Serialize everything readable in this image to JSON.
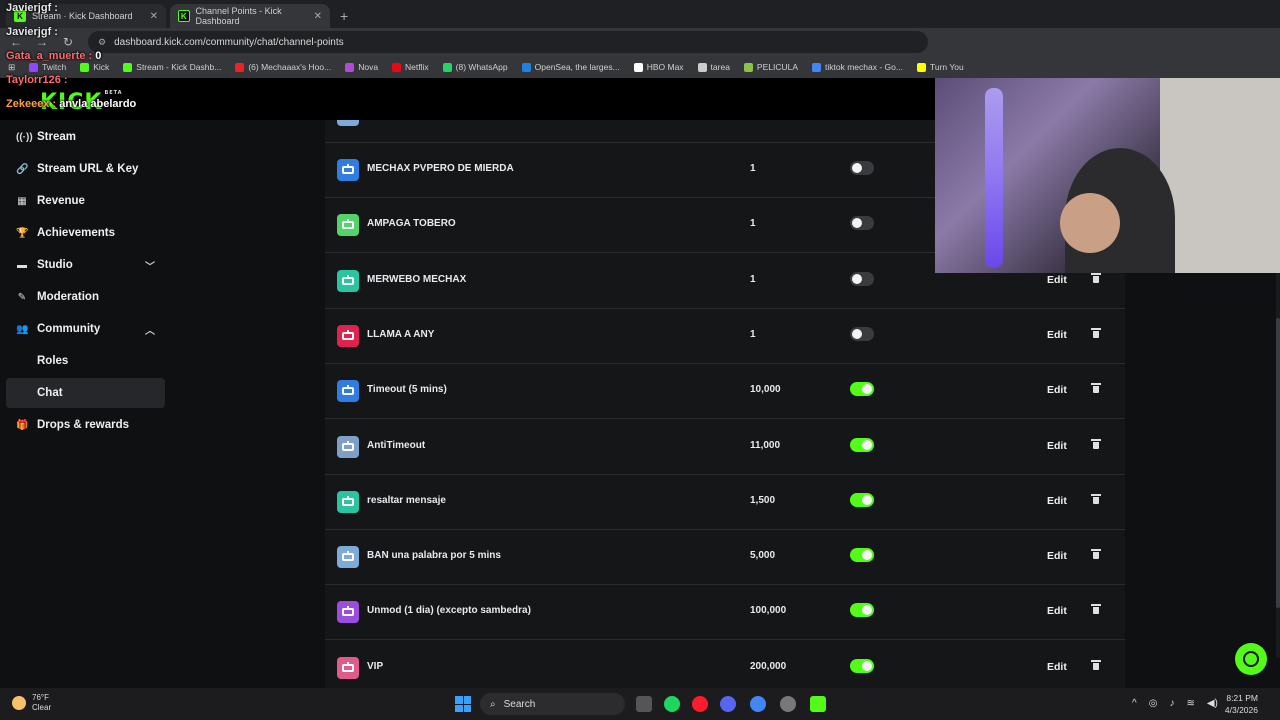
{
  "browser": {
    "tabs": [
      {
        "label": "Stream · Kick Dashboard",
        "active": false
      },
      {
        "label": "Channel Points - Kick Dashboard",
        "active": true
      }
    ],
    "url": "dashboard.kick.com/community/chat/channel-points",
    "bookmarks": [
      "Twitch",
      "Kick",
      "Stream - Kick Dashb...",
      "(6) Mechaaax's Hoo...",
      "Nova",
      "Netflix",
      "(8) WhatsApp",
      "OpenSea, the larges...",
      "HBO Max",
      "tarea",
      "PELICULA",
      "tiktok mechax - Go...",
      "Turn You"
    ]
  },
  "logo": {
    "text": "KICK",
    "tag": "BETA"
  },
  "sidebar": {
    "items": [
      {
        "label": "Stream",
        "icon": "broadcast-icon"
      },
      {
        "label": "Stream URL & Key",
        "icon": "link-icon"
      },
      {
        "label": "Revenue",
        "icon": "chart-icon"
      },
      {
        "label": "Achievements",
        "icon": "trophy-icon"
      },
      {
        "label": "Studio",
        "icon": "video-icon"
      },
      {
        "label": "Moderation",
        "icon": "wrench-icon"
      },
      {
        "label": "Community",
        "icon": "users-icon"
      },
      {
        "label": "Roles",
        "icon": ""
      },
      {
        "label": "Chat",
        "icon": ""
      },
      {
        "label": "Drops & rewards",
        "icon": "gift-icon"
      }
    ]
  },
  "rewards": [
    {
      "name": "MECHAX PVPERO DE MIERDA",
      "cost": "1",
      "enabled": false,
      "color": "#2f7de1"
    },
    {
      "name": "AMPAGA TOBERO",
      "cost": "1",
      "enabled": false,
      "color": "#53d36a"
    },
    {
      "name": "MERWEBO MECHAX",
      "cost": "1",
      "enabled": false,
      "color": "#2bc4a0"
    },
    {
      "name": "LLAMA A ANY",
      "cost": "1",
      "enabled": false,
      "color": "#e0234e"
    },
    {
      "name": "Timeout (5 mins)",
      "cost": "10,000",
      "enabled": true,
      "color": "#2f7de1"
    },
    {
      "name": "AntiTimeout",
      "cost": "11,000",
      "enabled": true,
      "color": "#7ea0c8"
    },
    {
      "name": "resaltar mensaje",
      "cost": "1,500",
      "enabled": true,
      "color": "#2bc4a0"
    },
    {
      "name": "BAN una palabra por 5 mins",
      "cost": "5,000",
      "enabled": true,
      "color": "#7eaad8"
    },
    {
      "name": "Unmod (1 dia) (excepto sambedra)",
      "cost": "100,000",
      "enabled": true,
      "color": "#9b4de0"
    },
    {
      "name": "VIP",
      "cost": "200,000",
      "enabled": true,
      "color": "#e05a8a"
    }
  ],
  "actions": {
    "edit": "Edit"
  },
  "chat_overlay": [
    {
      "user": "Javierjgf :",
      "msg": ""
    },
    {
      "user": "Javierjgf :",
      "msg": ""
    },
    {
      "user": "Gata_a_muerte :",
      "msg": "0"
    },
    {
      "user": "Taylorr126 :",
      "msg": ""
    },
    {
      "user": "Zekeeex :",
      "msg": "anvla abelardo"
    }
  ],
  "taskbar": {
    "weather_temp": "76°F",
    "weather_desc": "Clear",
    "search": "Search",
    "time": "8:21 PM",
    "date": "4/3/2026"
  }
}
